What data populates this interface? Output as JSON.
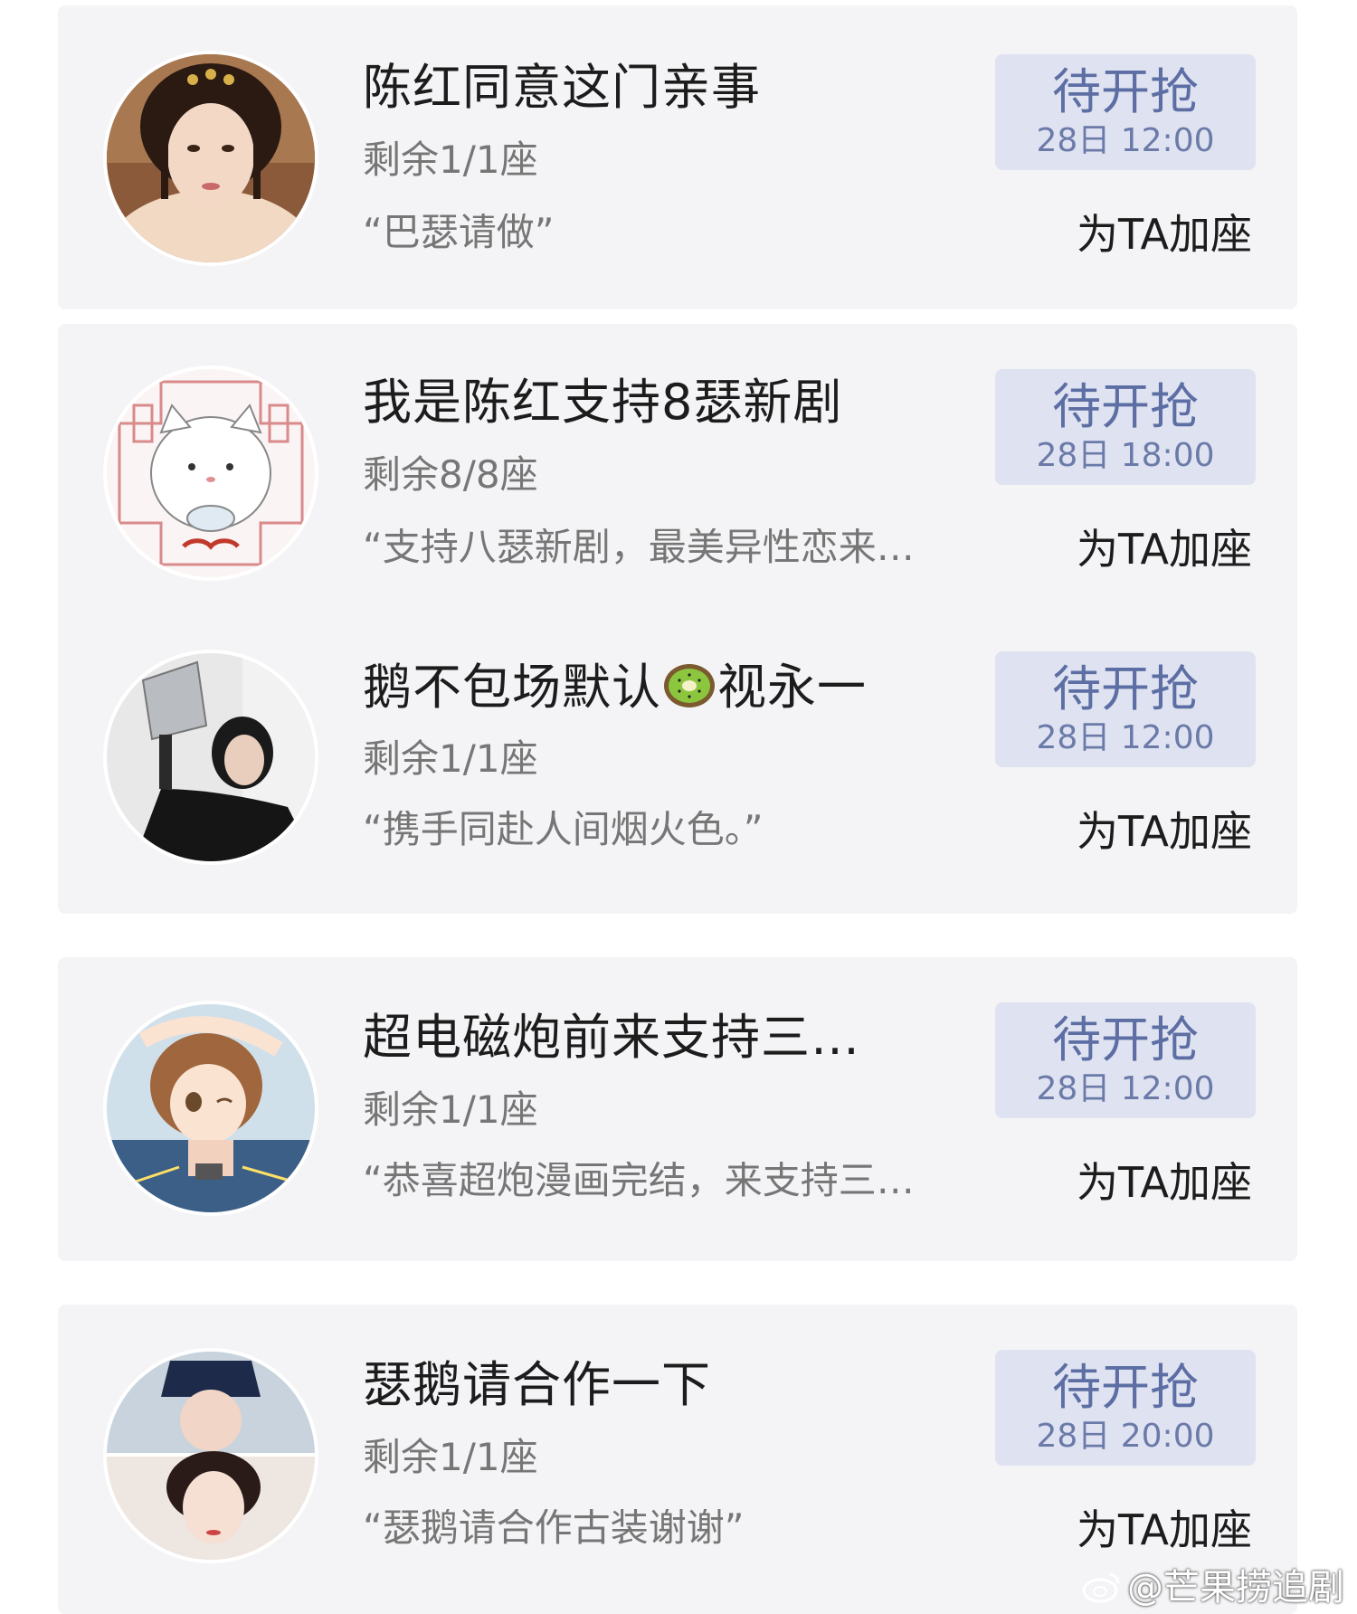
{
  "status": {
    "label": "待开抢",
    "add_label": "为TA加座"
  },
  "items": [
    {
      "title": "陈红同意这门亲事",
      "seats": "剩余1/1座",
      "quote": "“巴瑟请做”",
      "time": "28日 12:00"
    },
    {
      "title": "我是陈红支持8瑟新剧",
      "seats": "剩余8/8座",
      "quote": "“支持八瑟新剧，最美异性恋来…",
      "time": "28日 18:00"
    },
    {
      "title_before": "鹅不包场默认",
      "title_emoji": "kiwi-emoji",
      "title_after": "视永一",
      "seats": "剩余1/1座",
      "quote": "“携手同赴人间烟火色。”",
      "time": "28日 12:00"
    },
    {
      "title": "超电磁炮前来支持三…",
      "seats": "剩余1/1座",
      "quote": "“恭喜超炮漫画完结，来支持三…",
      "time": "28日 12:00"
    },
    {
      "title": "瑟鹅请合作一下",
      "seats": "剩余1/1座",
      "quote": "“瑟鹅请合作古装谢谢”",
      "time": "28日 20:00"
    }
  ],
  "watermark": {
    "icon": "weibo-icon",
    "text": "@芒果捞追剧"
  }
}
